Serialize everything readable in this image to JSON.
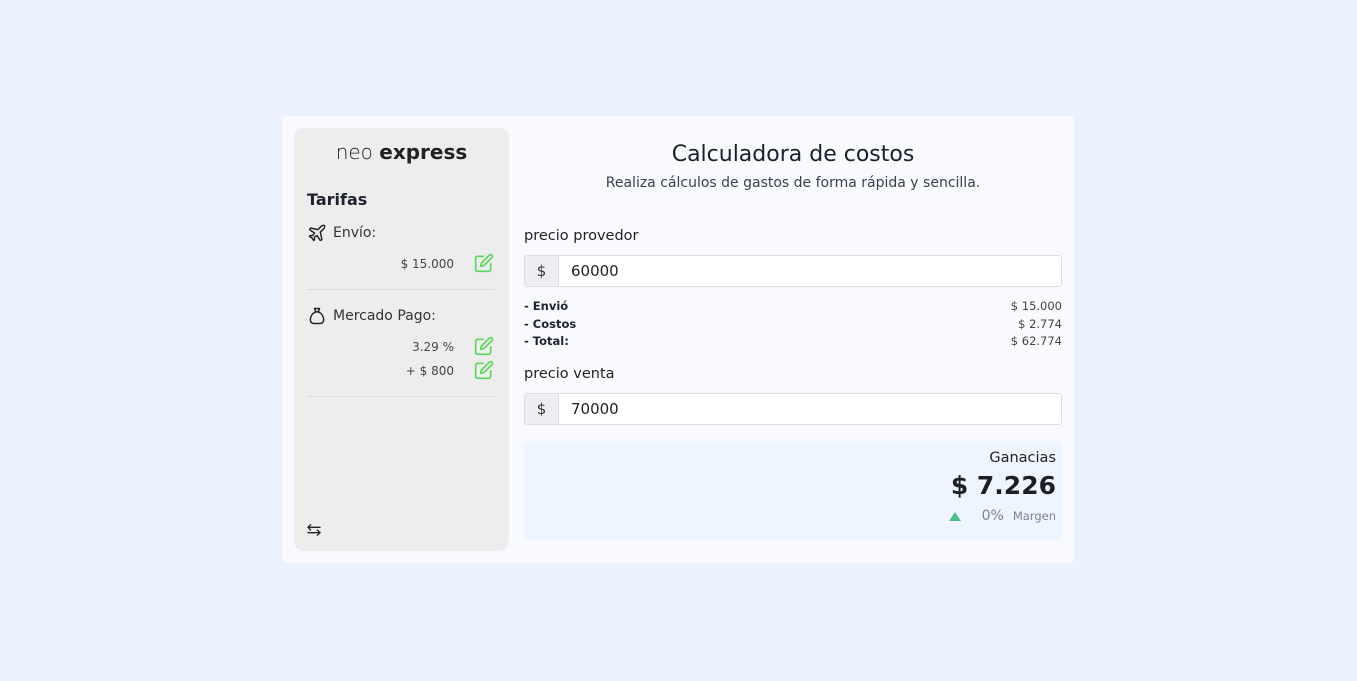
{
  "brand": {
    "light": "neo",
    "bold": "express"
  },
  "sidebar": {
    "section_title": "Tarifas",
    "envio": {
      "label": "Envío:",
      "value": "$ 15.000"
    },
    "mercado_pago": {
      "label": "Mercado Pago:",
      "percent": "3.29 %",
      "fixed": "+ $ 800"
    }
  },
  "main": {
    "title": "Calculadora de costos",
    "subtitle": "Realiza cálculos de gastos de forma rápida y sencilla.",
    "precio_proveedor": {
      "label": "precio provedor",
      "prefix": "$",
      "value": "60000"
    },
    "breakdown": [
      {
        "key": "- Envió",
        "value": "$ 15.000"
      },
      {
        "key": "- Costos",
        "value": "$ 2.774"
      },
      {
        "key": "- Total:",
        "value": "$ 62.774"
      }
    ],
    "precio_venta": {
      "label": "precio venta",
      "prefix": "$",
      "value": "70000"
    },
    "result": {
      "label": "Ganacias",
      "amount": "$ 7.226",
      "percent": "0%",
      "margin_label": "Margen"
    }
  },
  "colors": {
    "page_bg": "#ebf2fd",
    "card_bg": "#f8faff",
    "sidebar_bg": "#ededed",
    "edit_icon": "#5bd65b",
    "trend_up": "#4fbf8a"
  }
}
